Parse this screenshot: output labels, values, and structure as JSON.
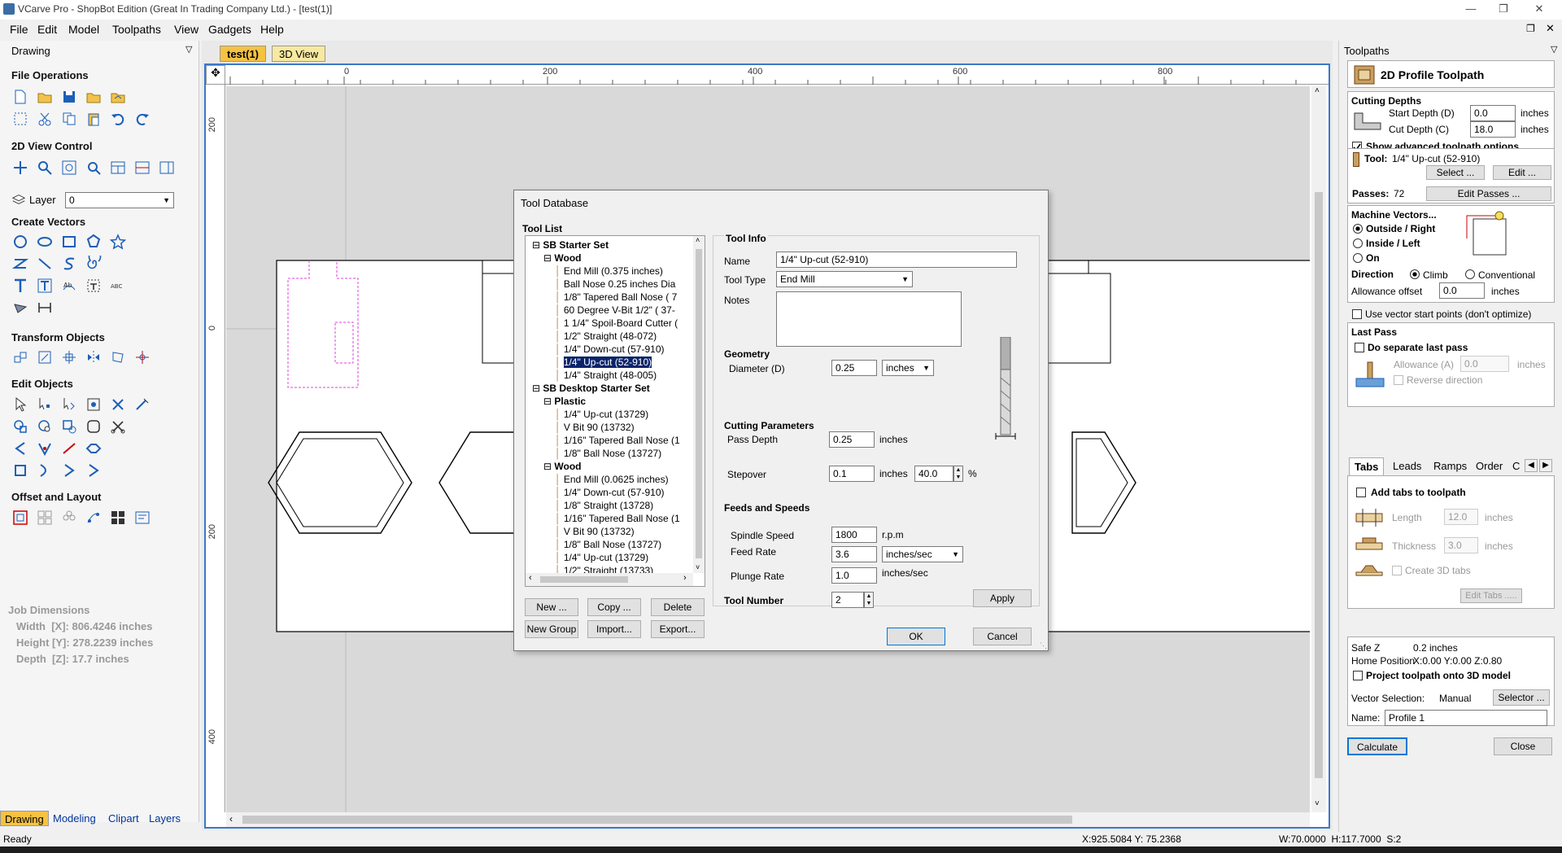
{
  "window": {
    "title": "VCarve Pro - ShopBot Edition (Great In Trading Company Ltd.) - [test(1)]"
  },
  "menu": [
    "File",
    "Edit",
    "Model",
    "Toolpaths",
    "View",
    "Gadgets",
    "Help"
  ],
  "left_panel": {
    "header": "Drawing",
    "sections": {
      "file_ops": "File Operations",
      "view_control": "2D View Control",
      "layer_label": "Layer",
      "layer_value": "0",
      "create_vectors": "Create Vectors",
      "transform": "Transform Objects",
      "edit_objects": "Edit Objects",
      "offset": "Offset and Layout"
    },
    "job": {
      "title": "Job Dimensions",
      "width": "Width  [X]: 806.4246 inches",
      "height": "Height [Y]: 278.2239 inches",
      "depth": "Depth  [Z]: 17.7 inches"
    },
    "bottom_tabs": [
      "Drawing",
      "Modeling",
      "Clipart",
      "Layers"
    ]
  },
  "doc_tabs": [
    "test(1)",
    "3D View"
  ],
  "ruler": {
    "h_labels": [
      "0",
      "200",
      "400",
      "600",
      "800"
    ],
    "v_labels": [
      "200",
      "0",
      "200",
      "400"
    ]
  },
  "dialog": {
    "title": "Tool Database",
    "tool_list_label": "Tool List",
    "tree": [
      {
        "label": "SB Starter Set",
        "level": 0,
        "bold": true
      },
      {
        "label": "Wood",
        "level": 1,
        "bold": true
      },
      {
        "label": "End Mill (0.375 inches)",
        "level": 2
      },
      {
        "label": "Ball Nose 0.25 inches Dia",
        "level": 2
      },
      {
        "label": "1/8\" Tapered Ball Nose  ( 7",
        "level": 2
      },
      {
        "label": "60 Degree V-Bit 1/2\"  ( 37-",
        "level": 2
      },
      {
        "label": "1 1/4\" Spoil-Board Cutter (",
        "level": 2
      },
      {
        "label": "1/2\" Straight  (48-072)",
        "level": 2
      },
      {
        "label": "1/4\"  Down-cut (57-910)",
        "level": 2
      },
      {
        "label": "1/4\" Up-cut (52-910)",
        "level": 2,
        "selected": true
      },
      {
        "label": "1/4\" Straight  (48-005)",
        "level": 2
      },
      {
        "label": "SB Desktop Starter Set",
        "level": 0,
        "bold": true
      },
      {
        "label": "Plastic",
        "level": 1,
        "bold": true
      },
      {
        "label": "1/4\" Up-cut (13729)",
        "level": 2
      },
      {
        "label": "V Bit 90 (13732)",
        "level": 2
      },
      {
        "label": "1/16\" Tapered Ball Nose (1",
        "level": 2
      },
      {
        "label": "1/8\" Ball Nose (13727)",
        "level": 2
      },
      {
        "label": "Wood",
        "level": 1,
        "bold": true
      },
      {
        "label": "End Mill (0.0625 inches)",
        "level": 2
      },
      {
        "label": "1/4\"  Down-cut (57-910)",
        "level": 2
      },
      {
        "label": "1/8\" Straight  (13728)",
        "level": 2
      },
      {
        "label": "1/16\" Tapered Ball Nose (1",
        "level": 2
      },
      {
        "label": "V Bit 90 (13732)",
        "level": 2
      },
      {
        "label": "1/8\" Ball Nose (13727)",
        "level": 2
      },
      {
        "label": "1/4\" Up-cut (13729)",
        "level": 2
      },
      {
        "label": "1/2\" Straight (13733)",
        "level": 2
      }
    ],
    "buttons": {
      "new": "New ...",
      "copy": "Copy ...",
      "delete": "Delete",
      "new_group": "New Group",
      "import": "Import...",
      "export": "Export...",
      "apply": "Apply",
      "ok": "OK",
      "cancel": "Cancel"
    },
    "tool_info": {
      "heading": "Tool Info",
      "name_label": "Name",
      "name_value": "1/4\" Up-cut (52-910)",
      "type_label": "Tool Type",
      "type_value": "End Mill",
      "notes_label": "Notes",
      "geometry_heading": "Geometry",
      "diameter_label": "Diameter (D)",
      "diameter_value": "0.25",
      "diameter_unit": "inches",
      "cutting_heading": "Cutting Parameters",
      "pass_depth_label": "Pass Depth",
      "pass_depth_value": "0.25",
      "pass_depth_unit": "inches",
      "stepover_label": "Stepover",
      "stepover_value": "0.1",
      "stepover_unit": "inches",
      "stepover_pct": "40.0",
      "pct": "%",
      "feeds_heading": "Feeds and Speeds",
      "spindle_label": "Spindle Speed",
      "spindle_value": "1800",
      "spindle_unit": "r.p.m",
      "feed_label": "Feed Rate",
      "feed_value": "3.6",
      "feed_unit": "inches/sec",
      "plunge_label": "Plunge Rate",
      "plunge_value": "1.0",
      "plunge_unit": "inches/sec",
      "toolnum_label": "Tool Number",
      "toolnum_value": "2"
    }
  },
  "right_panel": {
    "header": "Toolpaths",
    "title": "2D Profile Toolpath",
    "cutting_depths": "Cutting Depths",
    "start_depth_label": "Start Depth (D)",
    "start_depth_value": "0.0",
    "cut_depth_label": "Cut Depth (C)",
    "cut_depth_value": "18.0",
    "unit": "inches",
    "show_advanced": "Show advanced toolpath options",
    "tool_label": "Tool:",
    "tool_value": "1/4\" Up-cut (52-910)",
    "select_btn": "Select ...",
    "edit_btn": "Edit ...",
    "passes_label": "Passes:",
    "passes_value": "72",
    "edit_passes_btn": "Edit Passes ...",
    "machine_vectors": "Machine Vectors...",
    "outside": "Outside / Right",
    "inside": "Inside / Left",
    "on": "On",
    "direction": "Direction",
    "climb": "Climb",
    "conventional": "Conventional",
    "allowance_label": "Allowance offset",
    "allowance_value": "0.0",
    "use_vector_start": "Use vector start points (don't optimize)",
    "last_pass": "Last Pass",
    "do_separate": "Do separate last pass",
    "allowance_a": "Allowance (A)",
    "allowance_a_value": "0.0",
    "reverse": "Reverse direction",
    "tabs": [
      "Tabs",
      "Leads",
      "Ramps",
      "Order",
      "C"
    ],
    "add_tabs": "Add tabs to toolpath",
    "length_label": "Length",
    "length_value": "12.0",
    "thickness_label": "Thickness",
    "thickness_value": "3.0",
    "create_3d": "Create 3D tabs",
    "edit_tabs_btn": "Edit Tabs .....",
    "safe_z_label": "Safe Z",
    "safe_z_value": "0.2 inches",
    "home_label": "Home Position",
    "home_value": "X:0.00 Y:0.00 Z:0.80",
    "project": "Project toolpath onto 3D model",
    "vector_sel_label": "Vector Selection:",
    "vector_sel_value": "Manual",
    "selector_btn": "Selector ...",
    "name_label": "Name:",
    "name_value": "Profile 1",
    "calculate_btn": "Calculate",
    "close_btn": "Close"
  },
  "status": {
    "ready": "Ready",
    "coords": "X:925.5084 Y: 75.2368",
    "size": "W:70.0000  H:117.7000  S:2"
  },
  "colors": {
    "accent": "#3c78c8",
    "selected": "#0a246a",
    "tab_active": "#f5c242",
    "magenta": "#e040e0"
  }
}
